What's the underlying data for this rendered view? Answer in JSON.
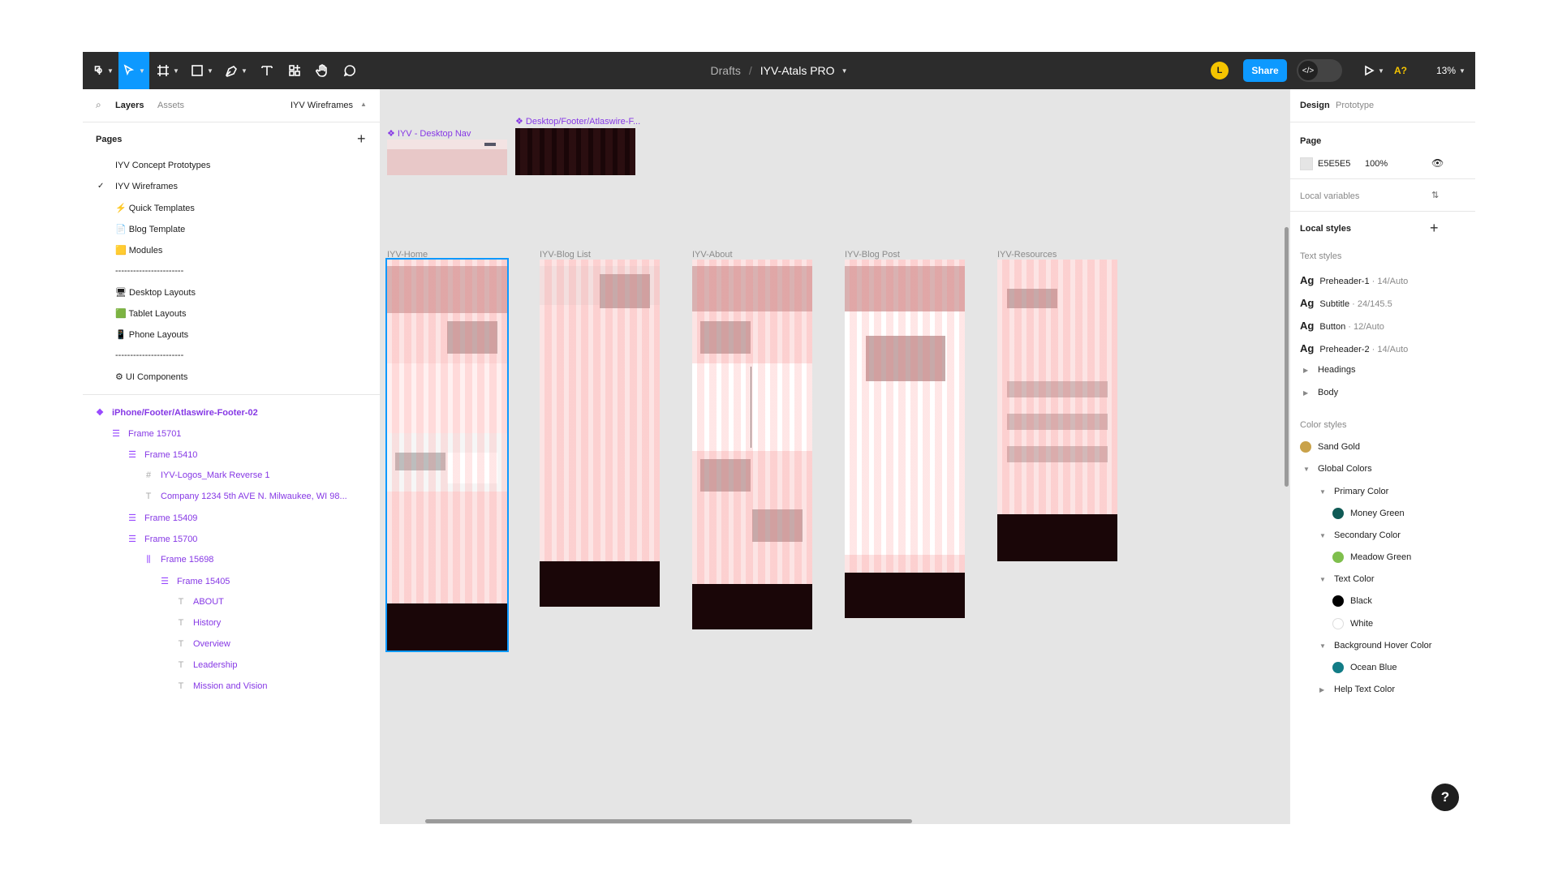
{
  "toolbar": {
    "breadcrumb_parent": "Drafts",
    "separator": "/",
    "file_name": "IYV-Atals PRO",
    "avatar_initial": "L",
    "share_label": "Share",
    "devmode_glyph": "</>",
    "a11y_label": "A?",
    "zoom_level": "13%"
  },
  "left_panel": {
    "tabs": {
      "layers": "Layers",
      "assets": "Assets",
      "page_selector": "IYV Wireframes"
    },
    "pages_heading": "Pages",
    "pages": [
      "IYV Concept Prototypes",
      "IYV Wireframes",
      "⚡ Quick Templates",
      "📄 Blog Template",
      "🟨 Modules",
      "-----------------------",
      "🖥 Desktop Layouts",
      "🟩 Tablet Layouts",
      "📱 Phone Layouts",
      "-----------------------",
      "⚙ UI Components"
    ],
    "current_page_check": "✓",
    "layers": [
      {
        "label": "iPhone/Footer/Atlaswire-Footer-02",
        "icon": "❖"
      },
      {
        "label": "Frame 15701",
        "icon": "☰"
      },
      {
        "label": "Frame 15410",
        "icon": "☰"
      },
      {
        "label": "IYV-Logos_Mark Reverse 1",
        "icon": "#"
      },
      {
        "label": "Company 1234 5th AVE N. Milwaukee, WI 98...",
        "icon": "T"
      },
      {
        "label": "Frame 15409",
        "icon": "☰"
      },
      {
        "label": "Frame 15700",
        "icon": "☰"
      },
      {
        "label": "Frame 15698",
        "icon": "⫼"
      },
      {
        "label": "Frame 15405",
        "icon": "☰"
      },
      {
        "label": "ABOUT",
        "icon": "T"
      },
      {
        "label": "History",
        "icon": "T"
      },
      {
        "label": "Overview",
        "icon": "T"
      },
      {
        "label": "Leadership",
        "icon": "T"
      },
      {
        "label": "Mission and Vision",
        "icon": "T"
      }
    ]
  },
  "canvas": {
    "component_labels": [
      "❖ IYV - Desktop Nav",
      "❖ Desktop/Footer/Atlaswire-F..."
    ],
    "frame_labels": [
      "IYV-Home",
      "IYV-Blog List",
      "IYV-About",
      "IYV-Blog Post",
      "IYV-Resources"
    ]
  },
  "right_panel": {
    "tabs": {
      "design": "Design",
      "prototype": "Prototype"
    },
    "page_heading": "Page",
    "page_color": "E5E5E5",
    "page_opacity": "100%",
    "local_variables": "Local variables",
    "local_styles": "Local styles",
    "text_styles_heading": "Text styles",
    "text_styles": [
      {
        "glyph": "Ag",
        "name": "Preheader-1",
        "spec": "14/Auto"
      },
      {
        "glyph": "Ag",
        "name": "Subtitle",
        "spec": "24/145.5"
      },
      {
        "glyph": "Ag",
        "name": "Button",
        "spec": "12/Auto"
      },
      {
        "glyph": "Ag",
        "name": "Preheader-2",
        "spec": "14/Auto"
      }
    ],
    "text_groups": [
      "Headings",
      "Body"
    ],
    "color_styles_heading": "Color styles",
    "color_styles": [
      {
        "name": "Sand Gold",
        "color": "#c9a24a",
        "kind": "swatch"
      },
      {
        "name": "Global Colors",
        "kind": "group"
      },
      {
        "name": "Primary Color",
        "kind": "subgroup"
      },
      {
        "name": "Money Green",
        "color": "#0f5a55",
        "kind": "swatch"
      },
      {
        "name": "Secondary Color",
        "kind": "subgroup"
      },
      {
        "name": "Meadow Green",
        "color": "#7fbf4d",
        "kind": "swatch"
      },
      {
        "name": "Text Color",
        "kind": "subgroup"
      },
      {
        "name": "Black",
        "color": "#000000",
        "kind": "swatch"
      },
      {
        "name": "White",
        "color": "#ffffff",
        "kind": "swatch"
      },
      {
        "name": "Background Hover Color",
        "kind": "subgroup"
      },
      {
        "name": "Ocean Blue",
        "color": "#127c86",
        "kind": "swatch"
      },
      {
        "name": "Help Text Color",
        "kind": "subgroup"
      }
    ],
    "help_glyph": "?"
  },
  "colors": {
    "accent": "#0d99ff",
    "component": "#8638e5",
    "toolbar": "#2c2c2c",
    "canvas": "#e5e5e5"
  }
}
